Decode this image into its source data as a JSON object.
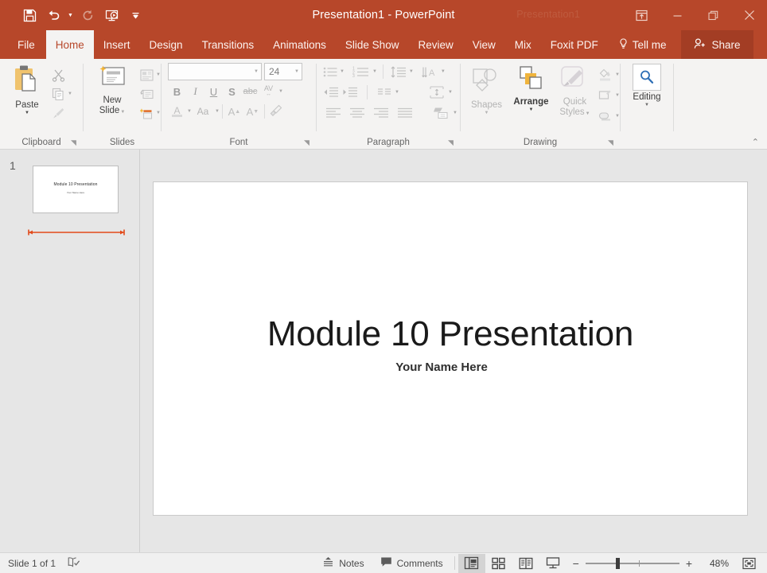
{
  "window": {
    "title": "Presentation1  -  PowerPoint",
    "ghost_title": "Presentation1",
    "accent_color": "#b7472a",
    "share_bg": "#a33d24",
    "quick_access": [
      {
        "name": "save-icon",
        "label": "Save",
        "enabled": true
      },
      {
        "name": "undo-icon",
        "label": "Undo",
        "enabled": true
      },
      {
        "name": "redo-icon",
        "label": "Redo",
        "enabled": false
      },
      {
        "name": "start-from-beginning-icon",
        "label": "Start From Beginning",
        "enabled": true
      },
      {
        "name": "customize-quick-access-icon",
        "label": "Customize Quick Access Toolbar",
        "enabled": true
      }
    ],
    "controls": [
      {
        "name": "ribbon-display-options-icon",
        "label": "Ribbon Display Options"
      },
      {
        "name": "minimize-icon",
        "label": "Minimize"
      },
      {
        "name": "restore-icon",
        "label": "Restore Down"
      },
      {
        "name": "close-icon",
        "label": "Close"
      }
    ]
  },
  "tabs": [
    {
      "label": "File",
      "active": false
    },
    {
      "label": "Home",
      "active": true
    },
    {
      "label": "Insert",
      "active": false
    },
    {
      "label": "Design",
      "active": false
    },
    {
      "label": "Transitions",
      "active": false
    },
    {
      "label": "Animations",
      "active": false
    },
    {
      "label": "Slide Show",
      "active": false
    },
    {
      "label": "Review",
      "active": false
    },
    {
      "label": "View",
      "active": false
    },
    {
      "label": "Mix",
      "active": false
    },
    {
      "label": "Foxit PDF",
      "active": false
    }
  ],
  "tellme": {
    "label": "Tell me"
  },
  "share": {
    "label": "Share"
  },
  "ribbon": {
    "groups": [
      {
        "label": "Clipboard"
      },
      {
        "label": "Slides"
      },
      {
        "label": "Font"
      },
      {
        "label": "Paragraph"
      },
      {
        "label": "Drawing"
      },
      {
        "label": ""
      }
    ],
    "clipboard": {
      "paste_label": "Paste",
      "cut_label": "Cut",
      "copy_label": "Copy",
      "format_painter_label": "Format Painter"
    },
    "slides": {
      "new_slide_label": "New\nSlide",
      "new_slide_line1": "New",
      "new_slide_line2": "Slide",
      "layout_label": "Layout",
      "reset_label": "Reset",
      "section_label": "Section"
    },
    "font": {
      "font_name_value": "",
      "font_name_placeholder": "",
      "font_size_value": "24",
      "bold": "B",
      "italic": "I",
      "underline": "U",
      "shadow": "S",
      "strikethrough": "abc",
      "char_spacing": "AV",
      "font_color": "A",
      "change_case": "Aa",
      "increase_size": "A",
      "decrease_size": "A",
      "clear_formatting_label": "Clear All Formatting"
    },
    "paragraph": {
      "bullets_label": "Bullets",
      "numbering_label": "Numbering",
      "line_spacing_label": "Line Spacing",
      "text_direction_label": "Text Direction",
      "decrease_indent_label": "Decrease Indent",
      "increase_indent_label": "Increase Indent",
      "columns_label": "Columns",
      "align_text_label": "Align Text",
      "align_left_label": "Align Left",
      "center_label": "Center",
      "align_right_label": "Align Right",
      "justify_label": "Justify",
      "smartart_label": "Convert to SmartArt"
    },
    "drawing": {
      "shapes_label": "Shapes",
      "arrange_label": "Arrange",
      "quick_styles_line1": "Quick",
      "quick_styles_line2": "Styles",
      "shape_fill_label": "Shape Fill",
      "shape_outline_label": "Shape Outline",
      "shape_effects_label": "Shape Effects"
    },
    "editing": {
      "editing_label": "Editing"
    },
    "collapse_label": "Collapse the Ribbon"
  },
  "thumbnails": {
    "items": [
      {
        "number": "1",
        "title": "Module 10 Presentation",
        "subtitle": "Your Name Here",
        "selected": true
      }
    ],
    "drag_indicator_color": "#e24a1a"
  },
  "slide": {
    "title": "Module 10 Presentation",
    "subtitle": "Your Name Here"
  },
  "statusbar": {
    "slide_count": "Slide 1 of 1",
    "accessibility_label": "Accessibility Checker",
    "notes_label": "Notes",
    "comments_label": "Comments",
    "views": [
      {
        "name": "normal-view-button",
        "label": "Normal",
        "selected": true
      },
      {
        "name": "slide-sorter-button",
        "label": "Slide Sorter",
        "selected": false
      },
      {
        "name": "reading-view-button",
        "label": "Reading View",
        "selected": false
      },
      {
        "name": "slide-show-button",
        "label": "Slide Show",
        "selected": false
      }
    ],
    "zoom_out_label": "−",
    "zoom_in_label": "+",
    "zoom_level": "48%",
    "fit_label": "Fit slide to current window"
  }
}
